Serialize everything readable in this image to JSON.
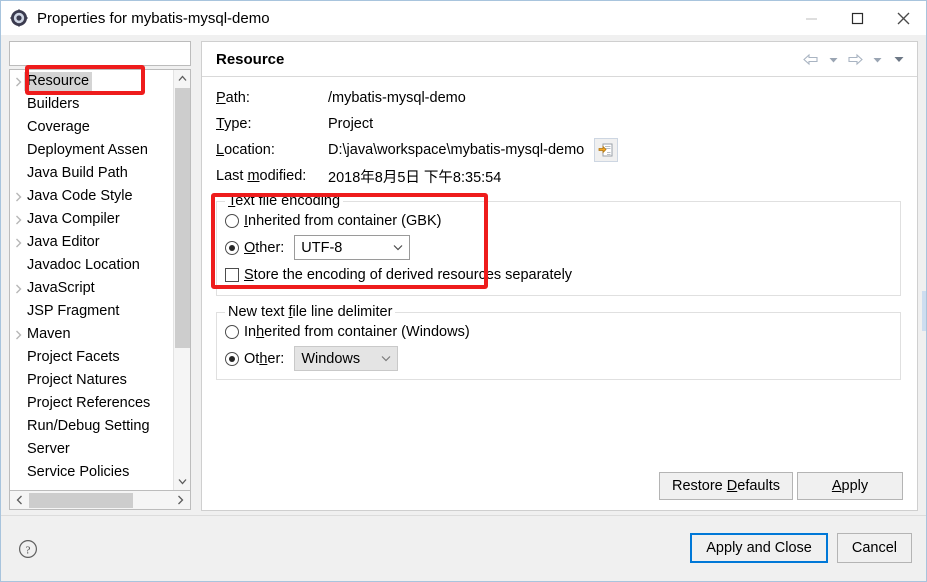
{
  "window": {
    "title": "Properties for mybatis-mysql-demo",
    "icon": "eclipse-properties-icon",
    "minimize_label": "Minimize",
    "maximize_label": "Maximize",
    "close_label": "Close"
  },
  "sidebar": {
    "filter": {
      "value": "",
      "placeholder": ""
    },
    "items": [
      {
        "label": "Resource",
        "expandable": true,
        "selected": true
      },
      {
        "label": "Builders",
        "expandable": false,
        "selected": false
      },
      {
        "label": "Coverage",
        "expandable": false,
        "selected": false
      },
      {
        "label": "Deployment Assen",
        "expandable": false,
        "selected": false
      },
      {
        "label": "Java Build Path",
        "expandable": false,
        "selected": false
      },
      {
        "label": "Java Code Style",
        "expandable": true,
        "selected": false
      },
      {
        "label": "Java Compiler",
        "expandable": true,
        "selected": false
      },
      {
        "label": "Java Editor",
        "expandable": true,
        "selected": false
      },
      {
        "label": "Javadoc Location",
        "expandable": false,
        "selected": false
      },
      {
        "label": "JavaScript",
        "expandable": true,
        "selected": false
      },
      {
        "label": "JSP Fragment",
        "expandable": false,
        "selected": false
      },
      {
        "label": "Maven",
        "expandable": true,
        "selected": false
      },
      {
        "label": "Project Facets",
        "expandable": false,
        "selected": false
      },
      {
        "label": "Project Natures",
        "expandable": false,
        "selected": false
      },
      {
        "label": "Project References",
        "expandable": false,
        "selected": false
      },
      {
        "label": "Run/Debug Setting",
        "expandable": false,
        "selected": false
      },
      {
        "label": "Server",
        "expandable": false,
        "selected": false
      },
      {
        "label": "Service Policies",
        "expandable": false,
        "selected": false
      }
    ]
  },
  "page": {
    "title": "Resource",
    "nav": {
      "back": "back-arrow",
      "back_menu": "back-dropdown",
      "forward": "forward-arrow",
      "forward_menu": "forward-dropdown",
      "view_menu": "view-menu"
    },
    "fields": {
      "path_label": "Path:",
      "path_value": "/mybatis-mysql-demo",
      "type_label": "Type:",
      "type_value": "Project",
      "location_label": "Location:",
      "location_value": "D:\\java\\workspace\\mybatis-mysql-demo",
      "location_button": "edit-location-icon",
      "modified_label": "Last modified:",
      "modified_value": "2018年8月5日 下午8:35:54"
    },
    "encoding_group": {
      "title": "Text file encoding",
      "inherited_label": "Inherited from container (GBK)",
      "inherited_selected": false,
      "other_label": "Other:",
      "other_selected": true,
      "other_value": "UTF-8",
      "store_derived_label": "Store the encoding of derived resources separately",
      "store_derived_checked": false
    },
    "delimiter_group": {
      "title": "New text file line delimiter",
      "inherited_label": "Inherited from container (Windows)",
      "inherited_selected": false,
      "other_label": "Other:",
      "other_selected": true,
      "other_value": "Windows",
      "other_disabled": true
    },
    "buttons": {
      "restore_defaults": "Restore Defaults",
      "apply": "Apply"
    }
  },
  "footer": {
    "help": "help-icon",
    "apply_and_close": "Apply and Close",
    "cancel": "Cancel"
  },
  "colors": {
    "annotation": "#ee1c1c",
    "default_button_border": "#0078d7",
    "selection": "#d4d4d4"
  }
}
